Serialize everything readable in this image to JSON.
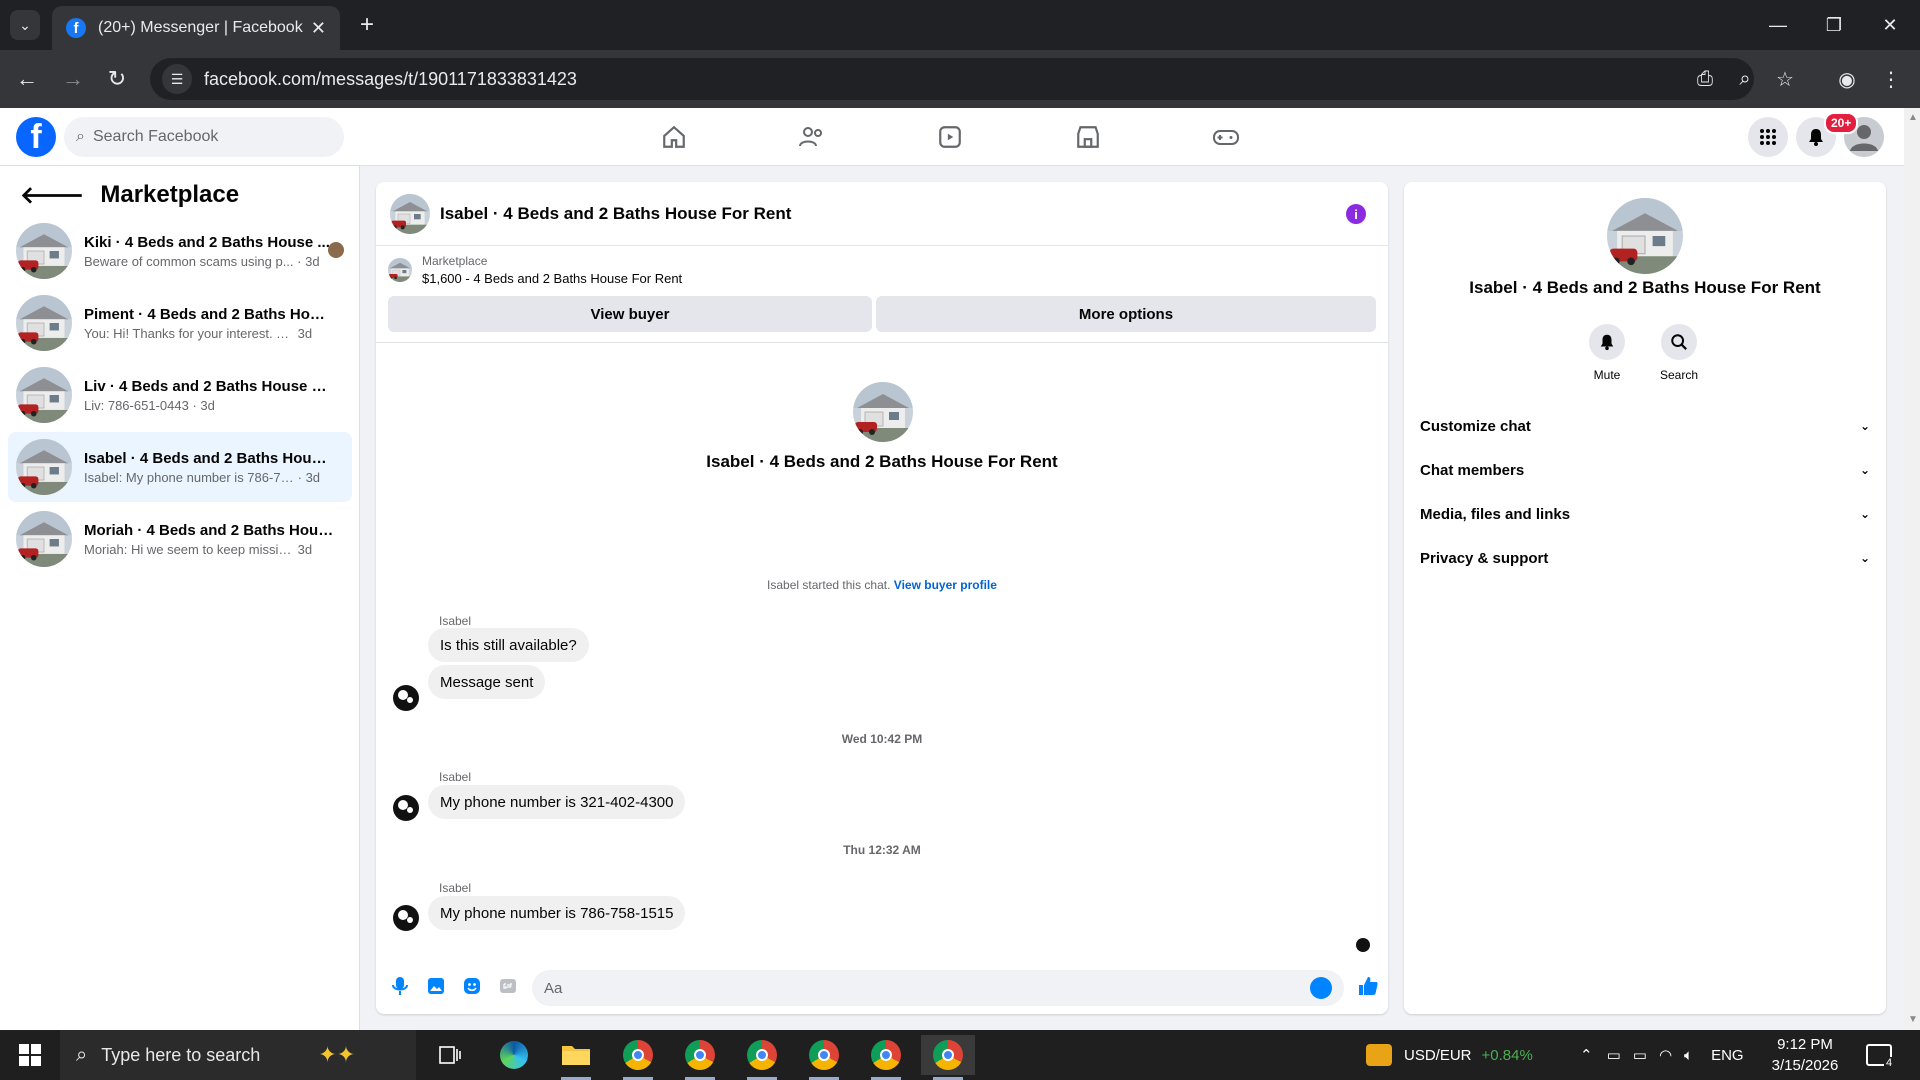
{
  "browser": {
    "tab_title": "(20+) Messenger | Facebook",
    "url": "facebook.com/messages/t/1901171833831423"
  },
  "fb": {
    "search_placeholder": "Search Facebook",
    "notifications_badge": "20+"
  },
  "sidebar": {
    "title": "Marketplace",
    "conversations": [
      {
        "name": "Kiki · 4 Beds and 2 Baths House ...",
        "preview": "Beware of common scams using p...",
        "time": "· 3d"
      },
      {
        "name": "Piment · 4 Beds and 2 Baths Hous...",
        "preview": "You: Hi! Thanks for your interest. To sh...",
        "time": "3d"
      },
      {
        "name": "Liv · 4 Beds and 2 Baths House For...",
        "preview": "Liv: 786-651-0443",
        "time": "· 3d"
      },
      {
        "name": "Isabel · 4 Beds and 2 Baths House ...",
        "preview": "Isabel: My phone number is 786-758-...",
        "time": "· 3d"
      },
      {
        "name": "Moriah · 4 Beds and 2 Baths Hous...",
        "preview": "Moriah: Hi we seem to keep missing e...",
        "time": "3d"
      }
    ]
  },
  "chat": {
    "title": "Isabel · 4 Beds and 2 Baths House For Rent",
    "marketplace_label": "Marketplace",
    "listing": "$1,600 - 4 Beds and 2 Baths House For Rent",
    "view_buyer": "View buyer",
    "more_options": "More options",
    "intro_name": "Isabel · 4 Beds and 2 Baths House For Rent",
    "started_text": "Isabel started this chat.",
    "view_buyer_profile": "View buyer profile",
    "messages": [
      {
        "sender": "Isabel",
        "text": "Is this still available?"
      },
      {
        "text": "Message sent"
      },
      {
        "timestamp": "Wed 10:42 PM"
      },
      {
        "sender": "Isabel",
        "text": "My phone number is 321-402-4300"
      },
      {
        "timestamp": "Thu 12:32 AM"
      },
      {
        "sender": "Isabel",
        "text": "My phone number is 786-758-1515"
      }
    ],
    "composer_placeholder": "Aa"
  },
  "rpanel": {
    "name": "Isabel · 4 Beds and 2 Baths House For Rent",
    "mute": "Mute",
    "search": "Search",
    "sections": [
      "Customize chat",
      "Chat members",
      "Media, files and links",
      "Privacy & support"
    ]
  },
  "taskbar": {
    "search_placeholder": "Type here to search",
    "currency": "USD/EUR",
    "currency_change": "+0.84%",
    "lang": "ENG",
    "time": "9:12 PM",
    "date": "3/15/2026",
    "notif_count": "4"
  },
  "colors": {
    "fb_blue": "#0866ff",
    "active_conv": "#ebf5ff",
    "badge_red": "#e41e3f",
    "link": "#0064d1",
    "positive": "#4caf50"
  }
}
